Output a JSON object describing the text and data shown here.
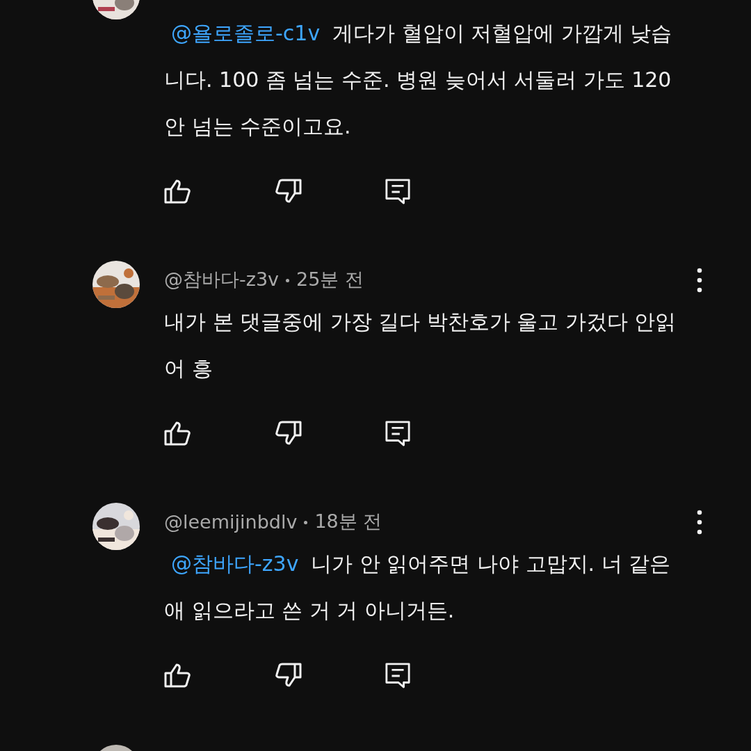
{
  "comments": [
    {
      "avatar": {
        "kind": "picture"
      },
      "mention": "@욜로졸로-c1v",
      "text": "게다가 혈압이 저혈압에 가깝게 낮습니다. 100 좀 넘는 수준. 병원 늦어서 서둘러 가도 120 안 넘는 수준이고요."
    },
    {
      "avatar": {
        "kind": "picture"
      },
      "author": "@참바다-z3v",
      "time": "25분 전",
      "text": "내가 본 댓글중에 가장 길다 박찬호가 울고 가겄다 안읽어 흥"
    },
    {
      "avatar": {
        "kind": "picture"
      },
      "author": "@leemijinbdlv",
      "time": "18분 전",
      "mention": "@참바다-z3v",
      "text": "니가 안 읽어주면 나야 고맙지. 너 같은 애 읽으라고 쓴 거 거 아니거든."
    },
    {
      "avatar": {
        "kind": "picture"
      }
    }
  ]
}
